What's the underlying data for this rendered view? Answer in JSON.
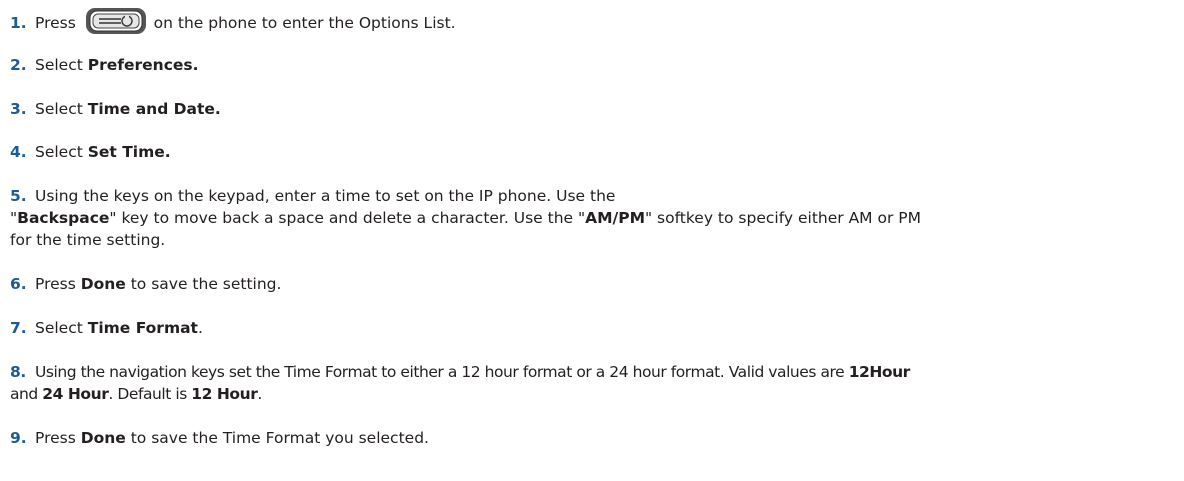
{
  "colors": {
    "step_number": "#1e5a96",
    "text": "#231f20",
    "key_body": "#555555"
  },
  "steps": [
    {
      "num": "1.",
      "parts": {
        "a": "Press",
        "icon": "options-key-icon",
        "b": "on the phone to enter the Options List."
      }
    },
    {
      "num": "2.",
      "parts": {
        "a": "Select ",
        "b": "Preferences."
      }
    },
    {
      "num": "3.",
      "parts": {
        "a": "Select ",
        "b": "Time and Date."
      }
    },
    {
      "num": "4.",
      "parts": {
        "a": "Select ",
        "b": "Set Time."
      }
    },
    {
      "num": "5.",
      "parts": {
        "line1": "Using the keys on the keypad, enter a time to set on the IP phone. Use the",
        "q1": "\"",
        "backspace": "Backspace",
        "mid": "\" key to move back a space and delete a character. Use the \"",
        "ampm": "AM/PM",
        "end": "\" softkey to specify either AM or PM",
        "line3": "for the time setting."
      }
    },
    {
      "num": "6.",
      "parts": {
        "a": "Press ",
        "b": "Done",
        "c": " to save the setting."
      }
    },
    {
      "num": "7.",
      "parts": {
        "a": "Select ",
        "b": "Time Format",
        "c": "."
      }
    },
    {
      "num": "8.",
      "parts": {
        "a": "Using the navigation keys set the Time Format to either a 12 hour format or a 24 hour format. Valid values are ",
        "b": "12Hour",
        "c": "and ",
        "d": "24 Hour",
        "e": ". Default is ",
        "f": "12 Hour",
        "g": "."
      }
    },
    {
      "num": "9.",
      "parts": {
        "a": "Press ",
        "b": "Done",
        "c": " to save the Time Format you selected."
      }
    }
  ]
}
